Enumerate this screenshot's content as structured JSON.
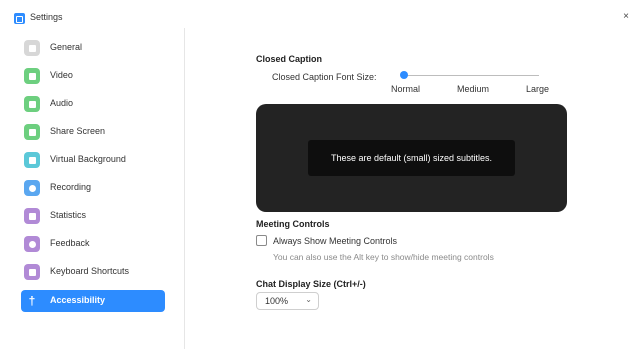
{
  "window": {
    "title": "Settings",
    "close_glyph": "×"
  },
  "sidebar": {
    "items": [
      {
        "label": "General",
        "icon": "gear-icon",
        "color": "#d7d7d7"
      },
      {
        "label": "Video",
        "icon": "video-icon",
        "color": "#6dcf7f"
      },
      {
        "label": "Audio",
        "icon": "headphones-icon",
        "color": "#6dcf7f"
      },
      {
        "label": "Share Screen",
        "icon": "share-screen-icon",
        "color": "#6dcf7f"
      },
      {
        "label": "Virtual Background",
        "icon": "virtual-background-icon",
        "color": "#5bc8d8"
      },
      {
        "label": "Recording",
        "icon": "recording-icon",
        "color": "#5aa7f0"
      },
      {
        "label": "Statistics",
        "icon": "statistics-icon",
        "color": "#b18ad6"
      },
      {
        "label": "Feedback",
        "icon": "feedback-icon",
        "color": "#b18ad6"
      },
      {
        "label": "Keyboard Shortcuts",
        "icon": "keyboard-icon",
        "color": "#b18ad6"
      },
      {
        "label": "Accessibility",
        "icon": "accessibility-icon",
        "color": "#2D8CFF"
      }
    ],
    "active_index": 9,
    "accessibility_glyph": "†"
  },
  "closed_caption": {
    "heading": "Closed Caption",
    "font_size_label": "Closed Caption Font Size:",
    "options": [
      "Normal",
      "Medium",
      "Large"
    ],
    "selected": "Normal",
    "preview_text": "These are default (small) sized subtitles."
  },
  "meeting_controls": {
    "heading": "Meeting Controls",
    "checkbox_label": "Always Show Meeting Controls",
    "checked": false,
    "hint": "You can also use the Alt key to show/hide meeting controls"
  },
  "chat_display": {
    "heading": "Chat Display Size (Ctrl+/-)",
    "value": "100%",
    "chevron": "⌄"
  },
  "colors": {
    "accent": "#2D8CFF",
    "preview_bg": "#232323",
    "caption_bg": "#0e0e0e"
  }
}
